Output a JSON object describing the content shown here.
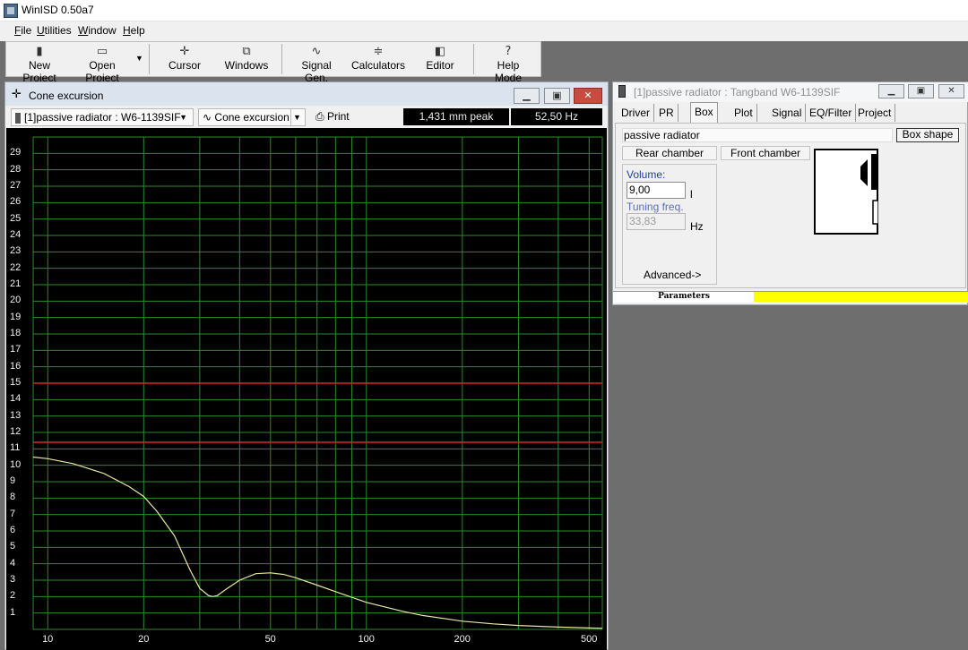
{
  "app": {
    "title": "WinISD 0.50a7",
    "colors": {
      "plot_bg": "#000000",
      "grid": "#2b8c2b",
      "curve": "#e8e8a0",
      "limit_line": "#d2282e",
      "yellow_bar": "#ffff00"
    }
  },
  "menu": [
    "File",
    "Utilities",
    "Window",
    "Help"
  ],
  "toolbar": {
    "new_project": "New Project",
    "open_project": "Open Project",
    "cursor": "Cursor",
    "windows": "Windows",
    "signal_gen": "Signal Gen.",
    "calculators": "Calculators",
    "editor": "Editor",
    "help_mode": "Help Mode",
    "icons": [
      "new-project-icon",
      "open-folder-icon",
      "cursor-crosshair-icon",
      "windows-icon",
      "signal-wave-icon",
      "calculators-icon",
      "editor-icon",
      "help-question-icon"
    ]
  },
  "cone_window": {
    "title": "Cone excursion",
    "project_select": "[1]passive radiator : W6-1139SIF",
    "graph_select": "Cone excursion",
    "print_label": "Print",
    "readout_peak": "1,431 mm peak",
    "readout_freq": "52,50 Hz"
  },
  "chart_data": {
    "type": "line",
    "x_scale": "log",
    "xlim": [
      9,
      550
    ],
    "ylim": [
      0,
      30
    ],
    "x_ticks": [
      "10",
      "20",
      "50",
      "100",
      "200",
      "500"
    ],
    "y_ticks": [
      "1",
      "2",
      "3",
      "4",
      "5",
      "6",
      "7",
      "8",
      "9",
      "10",
      "11",
      "12",
      "13",
      "14",
      "15",
      "16",
      "17",
      "18",
      "19",
      "20",
      "21",
      "22",
      "23",
      "24",
      "25",
      "26",
      "27",
      "28",
      "29"
    ],
    "grid": true,
    "limit_lines": [
      15,
      11.4
    ],
    "series": [
      {
        "x": [
          9,
          10,
          12,
          15,
          18,
          20,
          22,
          25,
          28,
          30,
          32,
          33,
          34,
          36,
          40,
          45,
          50,
          55,
          60,
          70,
          80,
          100,
          130,
          150,
          200,
          250,
          300,
          400,
          500,
          550
        ],
        "y": [
          10.5,
          10.4,
          10.1,
          9.5,
          8.7,
          8.1,
          7.2,
          5.7,
          3.6,
          2.5,
          2.05,
          2.0,
          2.05,
          2.4,
          3.0,
          3.4,
          3.45,
          3.35,
          3.15,
          2.7,
          2.3,
          1.65,
          1.1,
          0.85,
          0.5,
          0.34,
          0.24,
          0.14,
          0.09,
          0.07
        ]
      }
    ]
  },
  "box_window": {
    "title": "[1]passive radiator : Tangband W6-1139SIF",
    "tabs": [
      "Driver",
      "PR",
      "Box",
      "Plot",
      "Signal",
      "EQ/Filter",
      "Project"
    ],
    "box_type": "passive radiator",
    "box_shape_btn": "Box shape",
    "rear_chamber": "Rear chamber",
    "front_chamber": "Front chamber",
    "volume_label": "Volume:",
    "volume_value": "9,00",
    "volume_unit": "l",
    "tuning_label": "Tuning freq.",
    "tuning_value": "33,83",
    "tuning_unit": "Hz",
    "advanced": "Advanced->",
    "parameters": "Parameters"
  }
}
